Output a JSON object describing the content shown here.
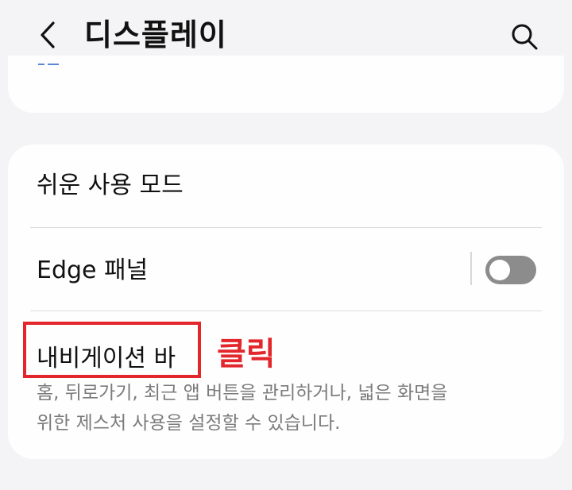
{
  "header": {
    "title": "디스플레이"
  },
  "settings": {
    "easy_mode_label": "쉬운 사용 모드",
    "edge_panels_label": "Edge 패널",
    "edge_panels_enabled": false,
    "navigation_bar_label": "내비게이션 바",
    "navigation_bar_desc_line1": "홈, 뒤로가기, 최근 앱 버튼을 관리하거나, 넓은 화면을",
    "navigation_bar_desc_line2": "위한 제스처 사용을 설정할 수 있습니다."
  },
  "annotation": {
    "text": "클릭",
    "color": "#e3262b"
  },
  "colors": {
    "background": "#f4f4f6",
    "card": "#fefefe",
    "toggle_off": "#8c8c8c",
    "secondary_text": "#7b7b7b"
  },
  "icons": {
    "back": "chevron-left-icon",
    "search": "search-icon"
  }
}
